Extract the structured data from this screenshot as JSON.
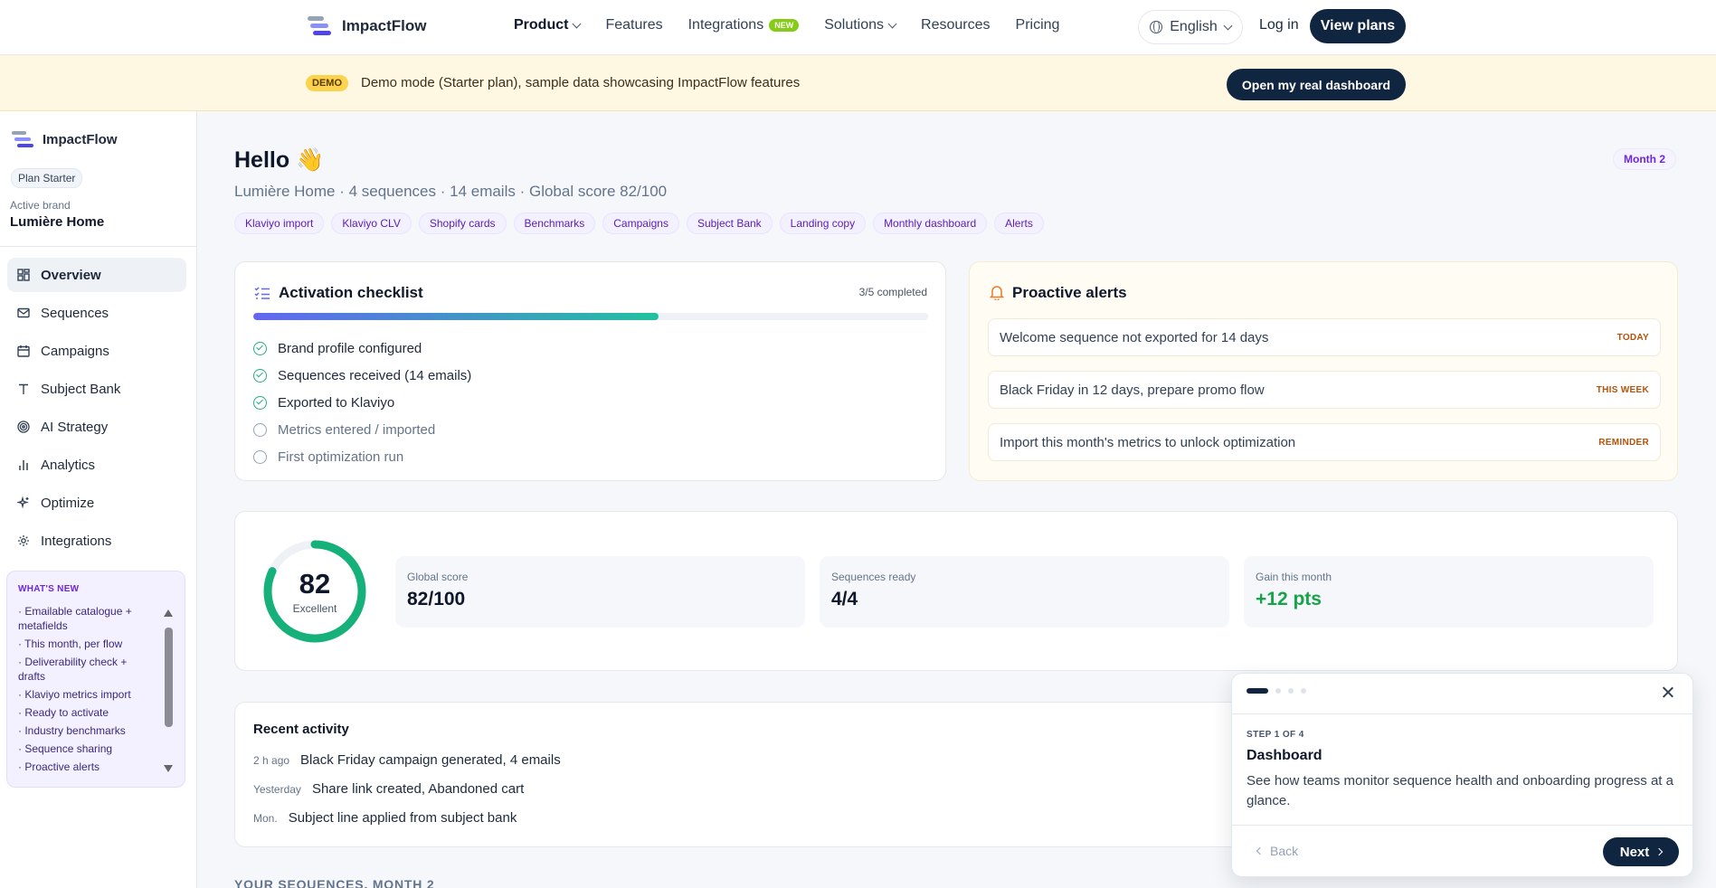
{
  "topnav": {
    "brand": "ImpactFlow",
    "links": [
      {
        "label": "Product",
        "dropdown": true
      },
      {
        "label": "Features"
      },
      {
        "label": "Integrations",
        "badge": "NEW"
      },
      {
        "label": "Solutions",
        "dropdown": true
      },
      {
        "label": "Resources"
      },
      {
        "label": "Pricing"
      }
    ],
    "language": "English",
    "login": "Log in",
    "cta": "View plans"
  },
  "demo": {
    "badge": "DEMO",
    "text": "Demo mode (Starter plan), sample data showcasing ImpactFlow features",
    "button": "Open my real dashboard"
  },
  "sidebar": {
    "brand": "ImpactFlow",
    "plan": "Plan Starter",
    "active_brand_label": "Active brand",
    "active_brand": "Lumière Home",
    "items": [
      {
        "label": "Overview",
        "icon": "grid-icon"
      },
      {
        "label": "Sequences",
        "icon": "mail-icon"
      },
      {
        "label": "Campaigns",
        "icon": "calendar-icon"
      },
      {
        "label": "Subject Bank",
        "icon": "type-icon"
      },
      {
        "label": "AI Strategy",
        "icon": "target-icon"
      },
      {
        "label": "Analytics",
        "icon": "bar-chart-icon"
      },
      {
        "label": "Optimize",
        "icon": "sparkles-icon"
      },
      {
        "label": "Integrations",
        "icon": "gear-icon"
      }
    ],
    "whats_new": {
      "title": "WHAT'S NEW",
      "items": [
        "· Emailable catalogue + metafields",
        "· This month, per flow",
        "· Deliverability check + drafts",
        "· Klaviyo metrics import",
        "· Ready to activate",
        "· Industry benchmarks",
        "· Sequence sharing",
        "· Proactive alerts"
      ]
    }
  },
  "main": {
    "greeting": "Hello 👋",
    "subline": "Lumière Home · 4 sequences · 14 emails · Global score 82/100",
    "month_badge": "Month 2",
    "chips": [
      "Klaviyo import",
      "Klaviyo CLV",
      "Shopify cards",
      "Benchmarks",
      "Campaigns",
      "Subject Bank",
      "Landing copy",
      "Monthly dashboard",
      "Alerts"
    ],
    "checklist": {
      "title": "Activation checklist",
      "count": "3/5 completed",
      "progress": 0.6,
      "items": [
        {
          "label": "Brand profile configured",
          "done": true
        },
        {
          "label": "Sequences received (14 emails)",
          "done": true
        },
        {
          "label": "Exported to Klaviyo",
          "done": true
        },
        {
          "label": "Metrics entered / imported",
          "done": false
        },
        {
          "label": "First optimization run",
          "done": false
        }
      ]
    },
    "alerts": {
      "title": "Proactive alerts",
      "items": [
        {
          "text": "Welcome sequence not exported for 14 days",
          "tag": "TODAY"
        },
        {
          "text": "Black Friday in 12 days, prepare promo flow",
          "tag": "THIS WEEK"
        },
        {
          "text": "Import this month's metrics to unlock optimization",
          "tag": "REMINDER"
        }
      ]
    },
    "score": {
      "value": "82",
      "fraction": 0.82,
      "label": "Excellent",
      "stats": [
        {
          "label": "Global score",
          "value": "82/100"
        },
        {
          "label": "Sequences ready",
          "value": "4/4"
        },
        {
          "label": "Gain this month",
          "value": "+12 pts"
        }
      ]
    },
    "activity": {
      "title": "Recent activity",
      "items": [
        {
          "when": "2 h ago",
          "what": "Black Friday campaign generated, 4 emails"
        },
        {
          "when": "Yesterday",
          "what": "Share link created, Abandoned cart"
        },
        {
          "when": "Mon.",
          "what": "Subject line applied from subject bank"
        }
      ]
    },
    "sequences_heading": "YOUR SEQUENCES, MONTH 2"
  },
  "tour": {
    "step": "STEP 1 OF 4",
    "title": "Dashboard",
    "description": "See how teams monitor sequence health and onboarding progress at a glance.",
    "back": "Back",
    "next": "Next"
  },
  "colors": {
    "navy": "#0f2540",
    "violet": "#6d28d9",
    "green": "#16a34a",
    "amber": "#b45309"
  }
}
